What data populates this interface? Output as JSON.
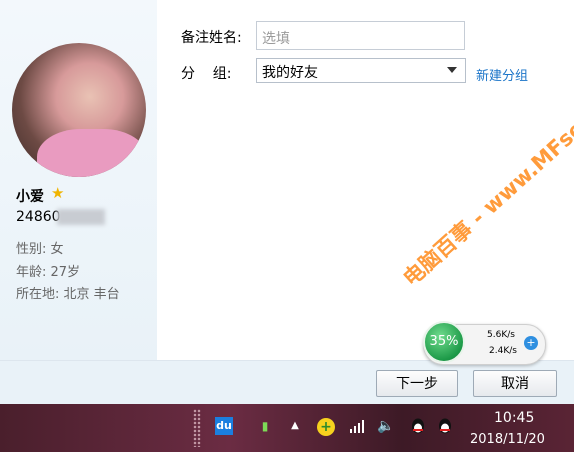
{
  "profile": {
    "nickname": "小爱",
    "qq_number": "24860",
    "gender": "性别: 女",
    "age": "年龄: 27岁",
    "location": "所在地: 北京  丰台"
  },
  "form": {
    "remark_label": "备注姓名:",
    "remark_placeholder": "选填",
    "group_label": "分    组:",
    "group_value": "我的好友",
    "new_group_link": "新建分组"
  },
  "buttons": {
    "next": "下一步",
    "cancel": "取消"
  },
  "speed_widget": {
    "percent": "35%",
    "upload": "5.6K/s",
    "download": "2.4K/s"
  },
  "taskbar": {
    "time": "10:45",
    "date": "2018/11/20"
  },
  "watermark": "电脑百事 - www.MFsese.com",
  "colors": {
    "link": "#1a74c8",
    "left_panel": "#eef5fa",
    "taskbar": "#5a2435",
    "star": "#f0b400"
  }
}
